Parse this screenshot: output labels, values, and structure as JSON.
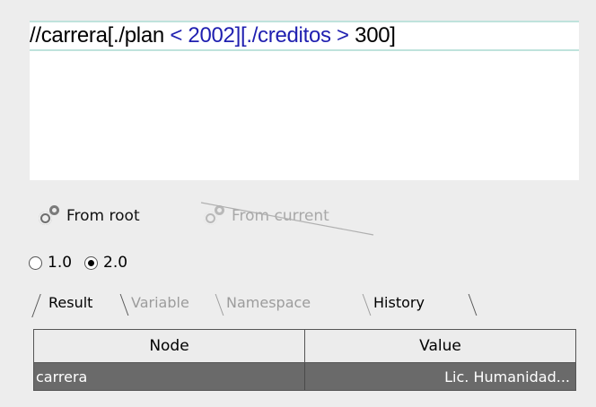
{
  "query": {
    "parts": [
      {
        "text": "//carrera[./plan ",
        "kind": "txt"
      },
      {
        "text": "< 2002][./creditos >",
        "kind": "kw"
      },
      {
        "text": " 300]",
        "kind": "txt"
      }
    ]
  },
  "toolbar": {
    "from_root_label": "From root",
    "from_current_label": "From current",
    "icon": "gears-icon"
  },
  "version": {
    "options": [
      "1.0",
      "2.0"
    ],
    "selected": "2.0"
  },
  "tabs": [
    {
      "label": "Result",
      "active": true
    },
    {
      "label": "Variable",
      "active": false
    },
    {
      "label": "Namespace",
      "active": false
    },
    {
      "label": "History",
      "active": false
    }
  ],
  "table": {
    "columns": [
      "Node",
      "Value"
    ],
    "rows": [
      {
        "node": "carrera",
        "value": "Lic. Humanidad..."
      }
    ]
  }
}
